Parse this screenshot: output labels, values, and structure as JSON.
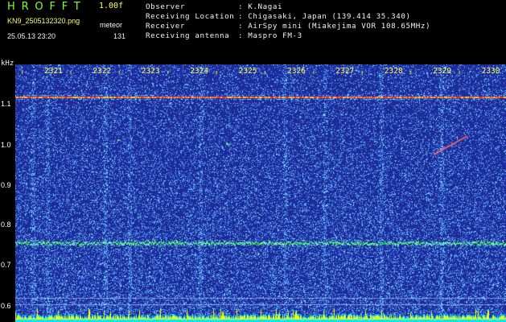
{
  "header": {
    "app_name": "HROFFT",
    "version": "1.00f",
    "file_name": "KN9_2505132320.png",
    "datetime": "25.05.13 23:20",
    "meteor_label": "meteor",
    "meteor_count": "131"
  },
  "info": {
    "observer_label": "Observer",
    "observer_value": ": K.Nagai",
    "location_label": "Receiving Location",
    "location_value": ": Chigasaki, Japan (139.414 35.340)",
    "receiver_label": "Receiver",
    "receiver_value": ": AirSpy mini (Miakejima VOR 108.65MHz)",
    "antenna_label": "Receiving antenna",
    "antenna_value": ": Maspro FM-3"
  },
  "spectrogram": {
    "y_unit": "kHz",
    "y_labels": [
      "1.1",
      "1.0",
      "0.9",
      "0.8",
      "0.7",
      "0.6"
    ],
    "time_labels": [
      "2321",
      "2322",
      "2323",
      "2324",
      "2325",
      "2326",
      "2327",
      "2328",
      "2329",
      "2330"
    ],
    "colors": {
      "background": "#1c2a9a",
      "noise_light": "#5fa8ff",
      "noise_cyan": "#7fe8ff",
      "line_red": "#ff3333",
      "line_green": "#33ff55",
      "baseline_yellow": "#ffff00",
      "baseline_cyan": "#00e8ff",
      "text_green": "#7fff3c",
      "text_yellow": "#ffff66"
    }
  }
}
